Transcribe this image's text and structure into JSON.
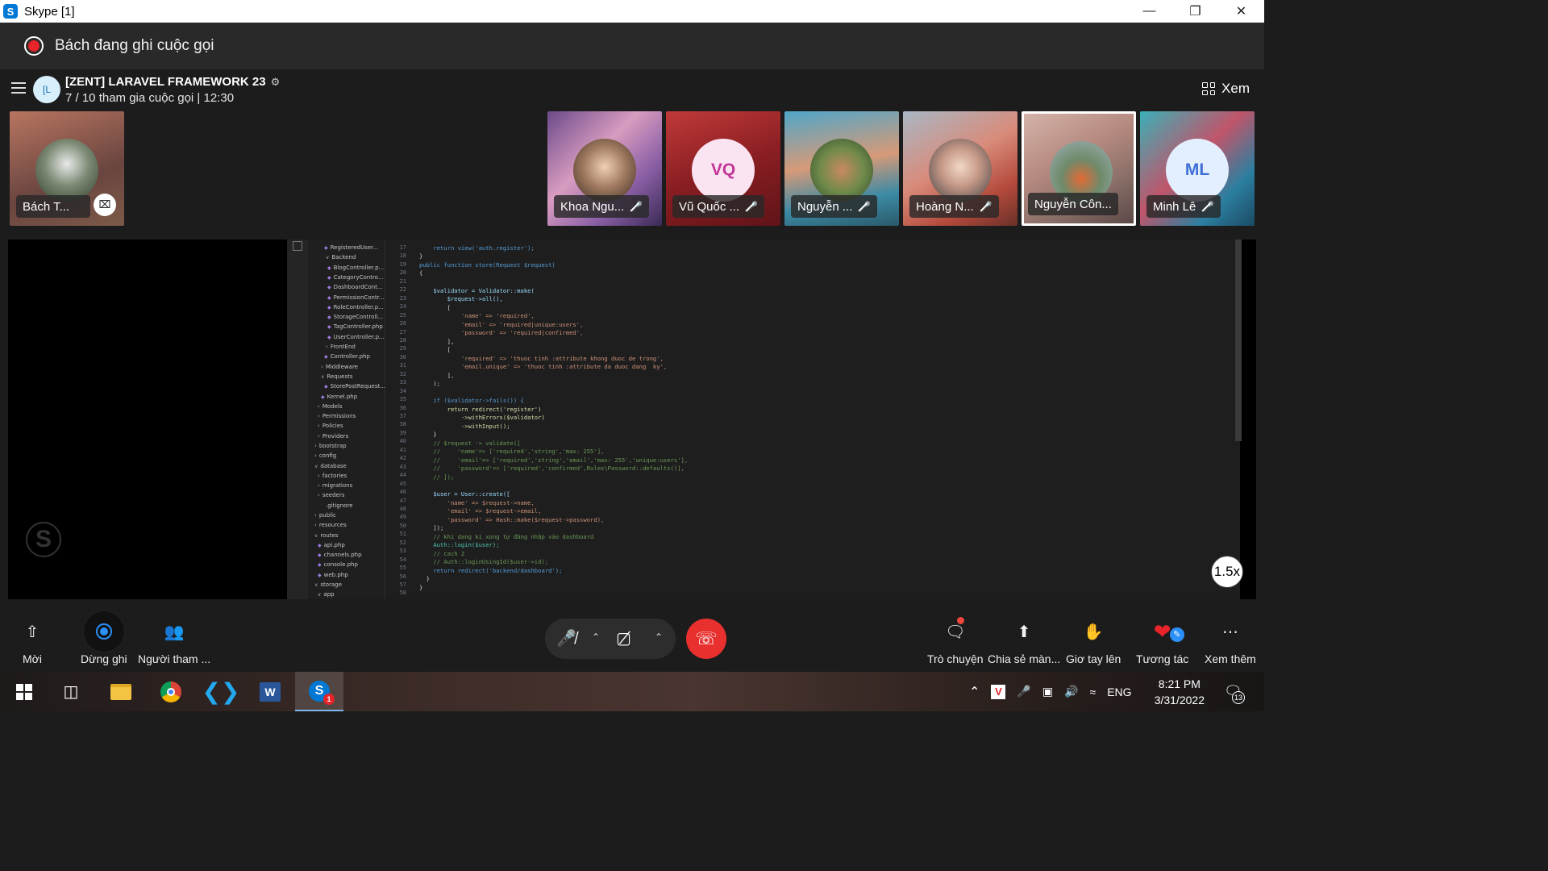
{
  "window": {
    "title": "Skype [1]",
    "app_icon": "S"
  },
  "recording": {
    "text": "Bách đang ghi cuộc gọi"
  },
  "call": {
    "group_initials": "[L",
    "group_name": "[ZENT] LARAVEL FRAMEWORK 23",
    "subtitle": "7 / 10 tham gia cuộc gọi | 12:30",
    "view_label": "Xem"
  },
  "self_tile": {
    "name": "Bách T..."
  },
  "participants": [
    {
      "name": "Khoa Ngu...",
      "initials": ""
    },
    {
      "name": "Vũ Quốc ...",
      "initials": "VQ"
    },
    {
      "name": "Nguyễn ...",
      "initials": ""
    },
    {
      "name": "Hoàng N...",
      "initials": ""
    },
    {
      "name": "Nguyễn Côn...",
      "initials": ""
    },
    {
      "name": "Minh Lê",
      "initials": "ML"
    }
  ],
  "explorer": [
    "RegisteredUser...",
    "Backend",
    "BlogController.p...",
    "CategoryContro...",
    "DashboardCont...",
    "PermissionContr...",
    "RoleController.p...",
    "StorageControll...",
    "TagController.php",
    "UserController.p...",
    "FrontEnd",
    "Controller.php",
    "Middleware",
    "Requests",
    "StorePostRequest...",
    "Kernel.php",
    "Models",
    "Permissions",
    "Policies",
    "Providers",
    "bootstrap",
    "config",
    "database",
    "factories",
    "migrations",
    "seeders",
    ".gitignore",
    "public",
    "resources",
    "routes",
    "api.php",
    "channels.php",
    "console.php",
    "web.php",
    "storage",
    "app"
  ],
  "code_lines": {
    "l17": "return view('auth.register');",
    "l18": "}",
    "l19": "public function store(Request $request)",
    "l20": "{",
    "l22": "$validator = Validator::make(",
    "l23": "$request->all(),",
    "l24": "[",
    "l25": "'name' => 'required',",
    "l26": "'email' => 'required|unique:users',",
    "l27": "'password' => 'required|confirmed',",
    "l28": "],",
    "l29": "[",
    "l30": "'required' => 'thuoc tinh :attribute khong duoc de trong',",
    "l31": "'email.unique' => 'thuoc tinh :attribute da duoc dang  ky',",
    "l32": "],",
    "l33": ");",
    "l35": "if ($validator->fails()) {",
    "l36": "return redirect('register')",
    "l37": "->withErrors($validator)",
    "l38": "->withInput();",
    "l39": "}",
    "l40": "// $request -> validate([",
    "l41": "//     'name'=> ['required','string','max: 255'],",
    "l42": "//     'email'=> ['required','string','email','max: 255','unique:users'],",
    "l43": "//     'password'=> ['required','confirmed',Rules\\Password::defaults()],",
    "l44": "// ]);",
    "l46": "$user = User::create([",
    "l47": "'name' => $request->name,",
    "l48": "'email' => $request->email,",
    "l49": "'password' => Hash::make($request->password),",
    "l50": "]);",
    "l51": "// khi dang ki xong tự đăng nhập vào dashboard",
    "l52": "Auth::login($user);",
    "l53": "// cach 2",
    "l54": "// Auth::loginUsingId($user->id);",
    "l55": "return redirect('backend/dashboard');",
    "l56": "}",
    "l57": "}"
  },
  "speed_badge": "1.5x",
  "controls": {
    "invite": "Mời",
    "stop_recording": "Dừng ghi",
    "participants": "Người tham ...",
    "chat": "Trò chuyện",
    "share_screen": "Chia sẻ màn...",
    "raise_hand": "Giơ tay lên",
    "react": "Tương tác",
    "more": "Xem thêm"
  },
  "taskbar": {
    "language": "ENG",
    "time": "8:21 PM",
    "date": "3/31/2022",
    "notification_count": "13"
  }
}
